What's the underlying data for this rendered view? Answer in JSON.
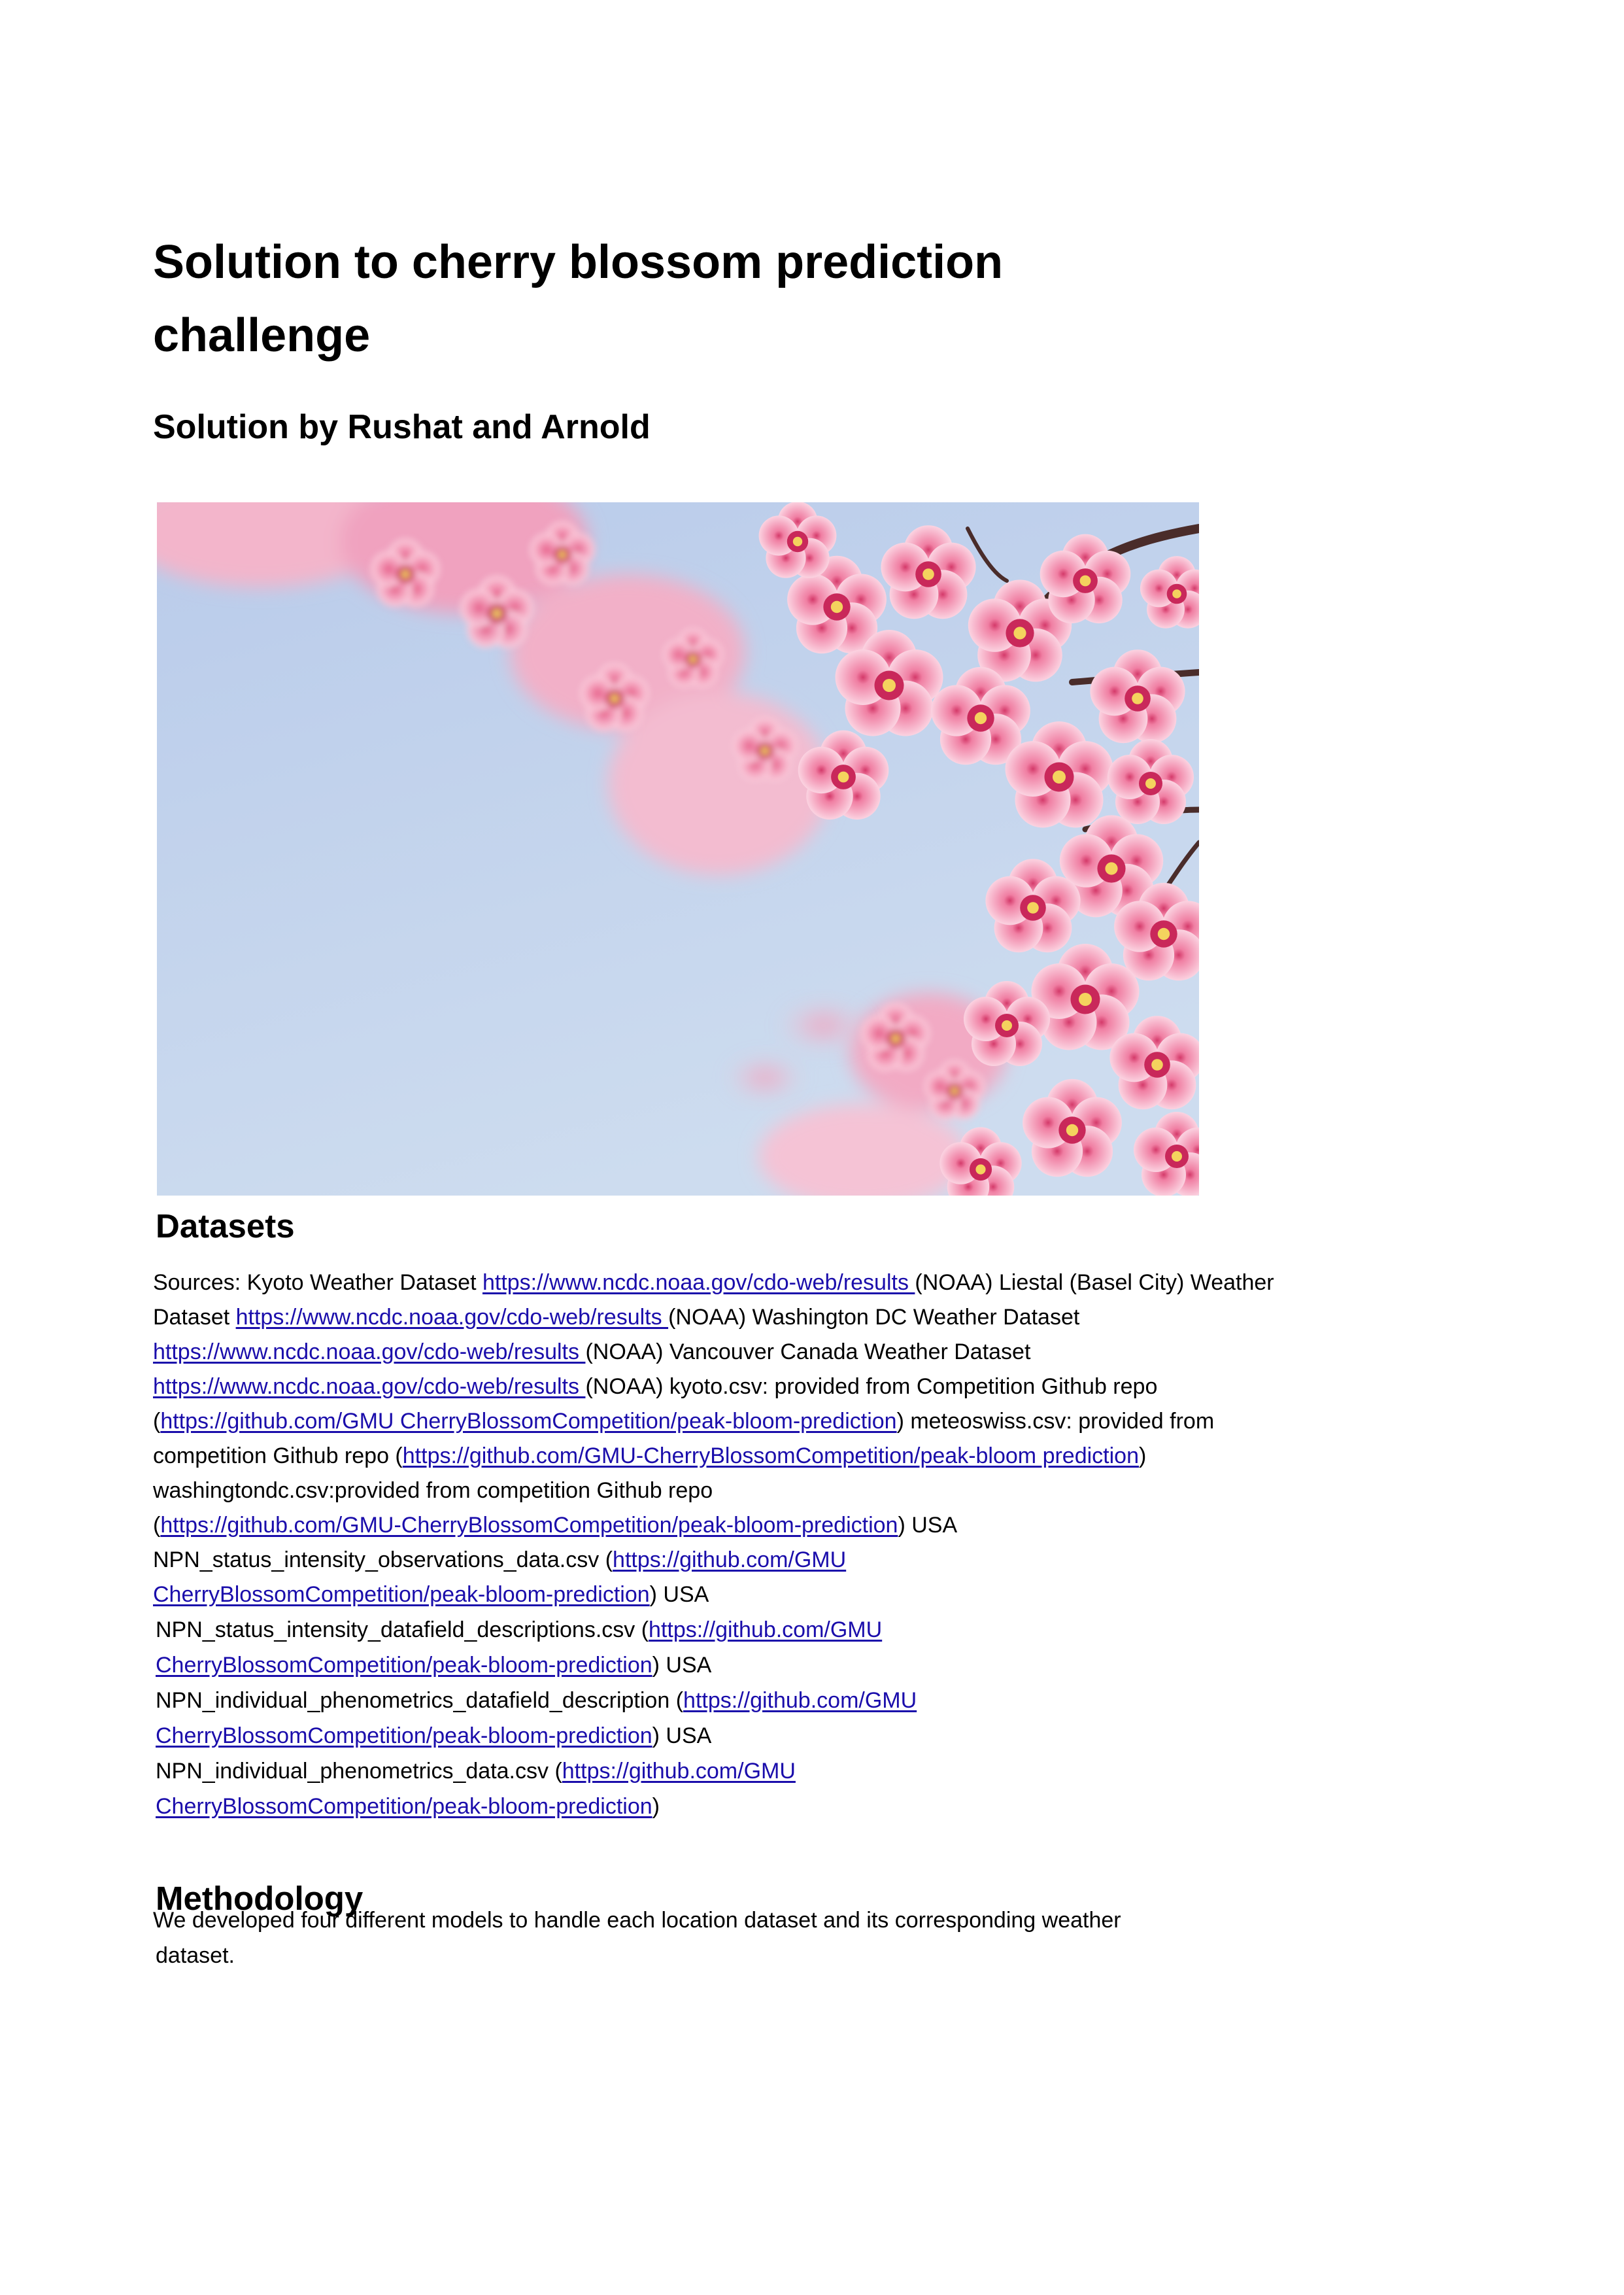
{
  "title": "Solution to cherry blossom prediction challenge",
  "subtitle": "Solution by Rushat and Arnold",
  "image": {
    "alt": "Pink cherry blossoms against a pale blue sky"
  },
  "colors": {
    "link": "#1a0dab",
    "text": "#000000",
    "sky": "#c7d7ee",
    "blossom": "#f2a7c0"
  },
  "datasets": {
    "heading": "Datasets",
    "lines": [
      [
        {
          "t": "Sources: Kyoto Weather Dataset "
        },
        {
          "t": "https://www.ncdc.noaa.gov/cdo-web/results ",
          "link": true
        },
        {
          "t": "(NOAA) Liestal (Basel City) Weather"
        }
      ],
      [
        {
          "t": "Dataset "
        },
        {
          "t": "https://www.ncdc.noaa.gov/cdo-web/results ",
          "link": true
        },
        {
          "t": "(NOAA) Washington DC Weather Dataset"
        }
      ],
      [
        {
          "t": "https://www.ncdc.noaa.gov/cdo-web/results ",
          "link": true
        },
        {
          "t": "(NOAA) Vancouver Canada Weather Dataset"
        }
      ],
      [
        {
          "t": "https://www.ncdc.noaa.gov/cdo-web/results ",
          "link": true
        },
        {
          "t": "(NOAA) kyoto.csv: provided from Competition Github repo"
        }
      ],
      [
        {
          "t": "("
        },
        {
          "t": "https://github.com/GMU CherryBlossomCompetition/peak-bloom-prediction",
          "link": true
        },
        {
          "t": ") meteoswiss.csv: provided from"
        }
      ],
      [
        {
          "t": "competition Github repo ("
        },
        {
          "t": "https://github.com/GMU-CherryBlossomCompetition/peak-bloom prediction",
          "link": true
        },
        {
          "t": ")"
        }
      ],
      [
        {
          "t": "washingtondc.csv:provided from competition Github repo"
        }
      ],
      [
        {
          "t": "("
        },
        {
          "t": "https://github.com/GMU-CherryBlossomCompetition/peak-bloom-prediction",
          "link": true
        },
        {
          "t": ") USA"
        }
      ],
      [
        {
          "t": "NPN_status_intensity_observations_data.csv ("
        },
        {
          "t": "https://github.com/GMU",
          "link": true
        }
      ],
      [
        {
          "t": "CherryBlossomCompetition/peak-bloom-prediction",
          "link": true
        },
        {
          "t": ") USA"
        }
      ],
      [
        {
          "t": "NPN_status_intensity_datafield_descriptions.csv ("
        },
        {
          "t": "https://github.com/GMU",
          "link": true
        }
      ],
      [
        {
          "t": "CherryBlossomCompetition/peak-bloom-prediction",
          "link": true
        },
        {
          "t": ") USA"
        }
      ],
      [
        {
          "t": "NPN_individual_phenometrics_datafield_description ("
        },
        {
          "t": "https://github.com/GMU",
          "link": true
        }
      ],
      [
        {
          "t": "CherryBlossomCompetition/peak-bloom-prediction",
          "link": true
        },
        {
          "t": ") USA"
        }
      ],
      [
        {
          "t": "NPN_individual_phenometrics_data.csv ("
        },
        {
          "t": "https://github.com/GMU",
          "link": true
        }
      ],
      [
        {
          "t": "CherryBlossomCompetition/peak-bloom-prediction",
          "link": true
        },
        {
          "t": ")"
        }
      ]
    ]
  },
  "methodology": {
    "heading": "Methodology",
    "lines": [
      "We developed four different models to handle each location dataset and its corresponding weather",
      "dataset."
    ]
  }
}
